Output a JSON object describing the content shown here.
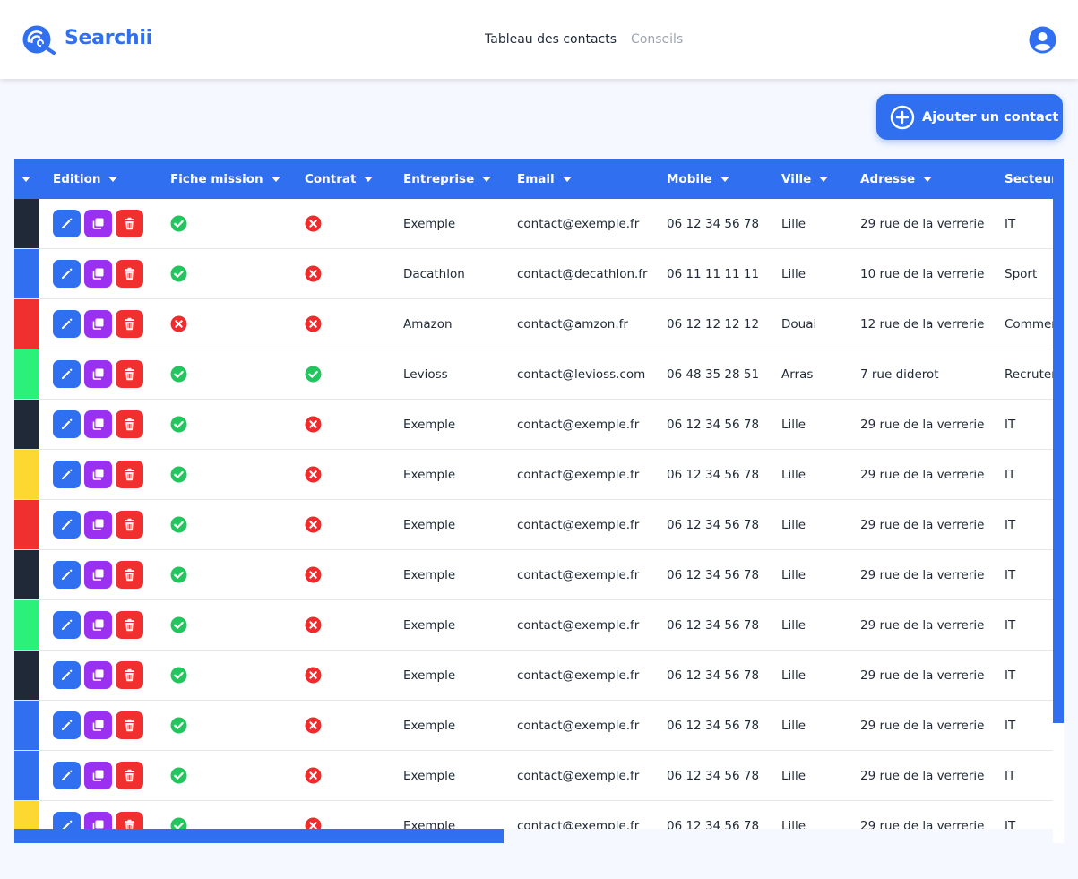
{
  "app": {
    "brand": "Searchii",
    "brand_color": "#2f6ff0"
  },
  "nav": {
    "items": [
      {
        "label": "Tableau des contacts",
        "active": true
      },
      {
        "label": "Conseils",
        "active": false
      }
    ]
  },
  "actions": {
    "add_contact": "Ajouter un contact"
  },
  "colors": {
    "primary": "#2f6ff0",
    "edit": "#2f6ff0",
    "copy": "#9b30f0",
    "delete": "#f0302e",
    "ok": "#22c55e",
    "ko": "#ef2b2b"
  },
  "table": {
    "columns": [
      "Edition",
      "Fiche mission",
      "Contrat",
      "Entreprise",
      "Email",
      "Mobile",
      "Ville",
      "Adresse",
      "Secteur"
    ],
    "rows": [
      {
        "color": "#1f2937",
        "fiche": true,
        "contrat": false,
        "entreprise": "Exemple",
        "email": "contact@exemple.fr",
        "mobile": "06 12 34 56 78",
        "ville": "Lille",
        "adresse": "29 rue de la verrerie",
        "secteur": "IT"
      },
      {
        "color": "#2f6ff0",
        "fiche": true,
        "contrat": false,
        "entreprise": "Dacathlon",
        "email": "contact@decathlon.fr",
        "mobile": "06 11 11 11 11",
        "ville": "Lille",
        "adresse": "10 rue de la verrerie",
        "secteur": "Sport"
      },
      {
        "color": "#f0302e",
        "fiche": false,
        "contrat": false,
        "entreprise": "Amazon",
        "email": "contact@amzon.fr",
        "mobile": "06 12 12 12 12",
        "ville": "Douai",
        "adresse": "12 rue de la verrerie",
        "secteur": "Commerce"
      },
      {
        "color": "#2bf07a",
        "fiche": true,
        "contrat": true,
        "entreprise": "Levioss",
        "email": "contact@levioss.com",
        "mobile": "06 48 35 28 51",
        "ville": "Arras",
        "adresse": "7 rue diderot",
        "secteur": "Recrutement"
      },
      {
        "color": "#1f2937",
        "fiche": true,
        "contrat": false,
        "entreprise": "Exemple",
        "email": "contact@exemple.fr",
        "mobile": "06 12 34 56 78",
        "ville": "Lille",
        "adresse": "29 rue de la verrerie",
        "secteur": "IT"
      },
      {
        "color": "#fdd830",
        "fiche": true,
        "contrat": false,
        "entreprise": "Exemple",
        "email": "contact@exemple.fr",
        "mobile": "06 12 34 56 78",
        "ville": "Lille",
        "adresse": "29 rue de la verrerie",
        "secteur": "IT"
      },
      {
        "color": "#f0302e",
        "fiche": true,
        "contrat": false,
        "entreprise": "Exemple",
        "email": "contact@exemple.fr",
        "mobile": "06 12 34 56 78",
        "ville": "Lille",
        "adresse": "29 rue de la verrerie",
        "secteur": "IT"
      },
      {
        "color": "#1f2937",
        "fiche": true,
        "contrat": false,
        "entreprise": "Exemple",
        "email": "contact@exemple.fr",
        "mobile": "06 12 34 56 78",
        "ville": "Lille",
        "adresse": "29 rue de la verrerie",
        "secteur": "IT"
      },
      {
        "color": "#2bf07a",
        "fiche": true,
        "contrat": false,
        "entreprise": "Exemple",
        "email": "contact@exemple.fr",
        "mobile": "06 12 34 56 78",
        "ville": "Lille",
        "adresse": "29 rue de la verrerie",
        "secteur": "IT"
      },
      {
        "color": "#1f2937",
        "fiche": true,
        "contrat": false,
        "entreprise": "Exemple",
        "email": "contact@exemple.fr",
        "mobile": "06 12 34 56 78",
        "ville": "Lille",
        "adresse": "29 rue de la verrerie",
        "secteur": "IT"
      },
      {
        "color": "#2f6ff0",
        "fiche": true,
        "contrat": false,
        "entreprise": "Exemple",
        "email": "contact@exemple.fr",
        "mobile": "06 12 34 56 78",
        "ville": "Lille",
        "adresse": "29 rue de la verrerie",
        "secteur": "IT"
      },
      {
        "color": "#2f6ff0",
        "fiche": true,
        "contrat": false,
        "entreprise": "Exemple",
        "email": "contact@exemple.fr",
        "mobile": "06 12 34 56 78",
        "ville": "Lille",
        "adresse": "29 rue de la verrerie",
        "secteur": "IT"
      },
      {
        "color": "#fdd830",
        "fiche": true,
        "contrat": false,
        "entreprise": "Exemple",
        "email": "contact@exemple.fr",
        "mobile": "06 12 34 56 78",
        "ville": "Lille",
        "adresse": "29 rue de la verrerie",
        "secteur": "IT"
      }
    ]
  }
}
